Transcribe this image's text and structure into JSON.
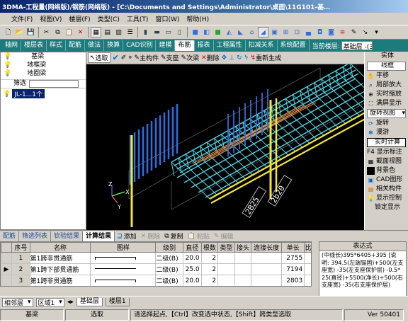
{
  "window": {
    "title": "3DMA-工程量(网络版)/钢筋(网络版) - [C:\\Documents and Settings\\Administrator\\桌面\\11G101-基…"
  },
  "menu": [
    "文件(F)",
    "视图(V)",
    "楼层(F)",
    "类型(C)",
    "工具(T)",
    "窗口(W)",
    "帮助(H)"
  ],
  "tabs": [
    "轴网",
    "楼层表",
    "样式",
    "配筋",
    "做法",
    "换算",
    "CAD识别",
    "建模",
    "布筋",
    "报表",
    "工程属性",
    "扣减关系",
    "系统配置"
  ],
  "active_tab": "布筋",
  "floor": {
    "label": "当前楼层:",
    "value": "基础层 -(3)"
  },
  "tree": {
    "items": [
      "基梁",
      "地框梁",
      "地圈梁"
    ],
    "filter_label": "筛选",
    "list_item": "JL-1...1个"
  },
  "viewbar": [
    "选取",
    "主构件",
    "支座",
    "次梁",
    "删除",
    "重新生成"
  ],
  "viewport": {
    "dim_labels": [
      "2B25",
      "2b20"
    ],
    "axes": [
      "Z",
      "X",
      "Y"
    ]
  },
  "right": {
    "title": "实体",
    "mode": "线框",
    "items": [
      "平移",
      "局部放大",
      "实时缩放",
      "满屏显示"
    ],
    "rotate_view": "旋转视图",
    "rotate": "旋转",
    "roam": "漫游",
    "realtime": "实时计算",
    "f4": "F4 显示标注",
    "section": "截面视图",
    "bgcolor": "背景色",
    "cad": "CAD图形",
    "related": "相关构件",
    "display_ctrl": "显示控制",
    "lock_display": "锁定显示"
  },
  "bottom_tabs": [
    "配筋",
    "筛选列表",
    "钦验结果",
    "计算结果"
  ],
  "bottom_actions": {
    "add": "添加",
    "del": "删除",
    "copy": "复制",
    "paste": "粘贴",
    "edit": "编辑"
  },
  "table": {
    "headers": [
      "序号",
      "名称",
      "图样",
      "级别",
      "直径",
      "根数",
      "类型",
      "接头",
      "连接长度",
      "单长",
      "比"
    ],
    "rows": [
      [
        "1",
        "第1跨非贯通筋",
        "",
        "二级(B)",
        "20.0",
        "2",
        "",
        "",
        "",
        "2755"
      ],
      [
        "2",
        "第1跨下部贯通筋",
        "",
        "二级(B)",
        "25.0",
        "2",
        "",
        "",
        "",
        "7194"
      ],
      [
        "3",
        "第1跨非贯通筋",
        "",
        "二级(B)",
        "20.0",
        "2",
        "",
        "",
        "",
        "2803"
      ]
    ]
  },
  "formula": {
    "title": "表达式",
    "text": "(中线长)395*6405+395 [说明: 394.5(左端锚固)+500(左支座宽) -35(左支座保护层) -0.5*25(直径)+5500(净长)+500(右支座宽) -35(右支座保护层)"
  },
  "sheetbar": {
    "floor": "相邻层",
    "region": "区域1",
    "sheets": [
      "基础层",
      "楼层1"
    ]
  },
  "status": {
    "cells": [
      "基梁",
      "选取",
      "请选择起点,【Ctrl】改变选中状态,【Shift】跨类型选取"
    ],
    "version": "Ver 50401"
  },
  "colors": {
    "accent": "#1d7b7b",
    "title": "#0a246a",
    "rebar": "#4fd6e6",
    "yellow": "#f5e633",
    "blue": "#2f6de0"
  }
}
